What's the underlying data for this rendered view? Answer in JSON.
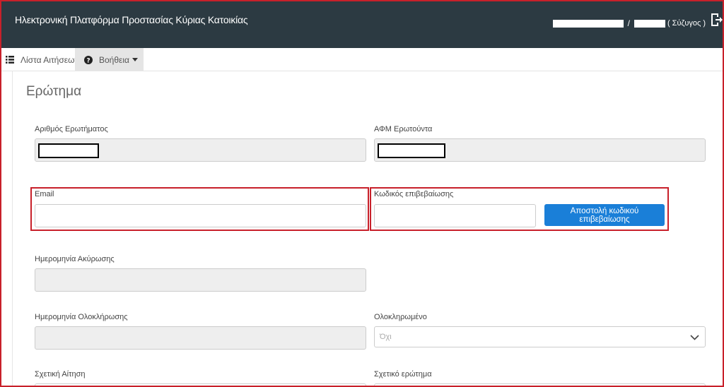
{
  "header": {
    "title": "Ηλεκτρονική Πλατφόρμα Προστασίας Κύριας Κατοικίας",
    "user_separator": "/",
    "user_role": "( Σύζυγος )"
  },
  "nav": {
    "list_label": "Λίστα Αιτήσεων",
    "help_label": "Βοήθεια"
  },
  "form": {
    "title": "Ερώτημα",
    "question_number_label": "Αριθμός Ερωτήματος",
    "afm_label": "ΑΦΜ Ερωτούντα",
    "email_label": "Email",
    "email_value": "",
    "code_label": "Κωδικός επιβεβαίωσης",
    "code_value": "",
    "send_code_button": "Αποστολή κωδικού επιβεβαίωσης",
    "cancel_date_label": "Ημερομηνία Ακύρωσης",
    "completion_date_label": "Ημερομηνία Ολοκλήρωσης",
    "completed_label": "Ολοκληρωμένο",
    "completed_value": "Όχι",
    "related_application_label": "Σχετική Αίτηση",
    "related_question_label": "Σχετικό ερώτημα"
  },
  "colors": {
    "topbar": "#2c3a42",
    "primary_button": "#1a7fd8",
    "highlight": "#c8202a"
  }
}
